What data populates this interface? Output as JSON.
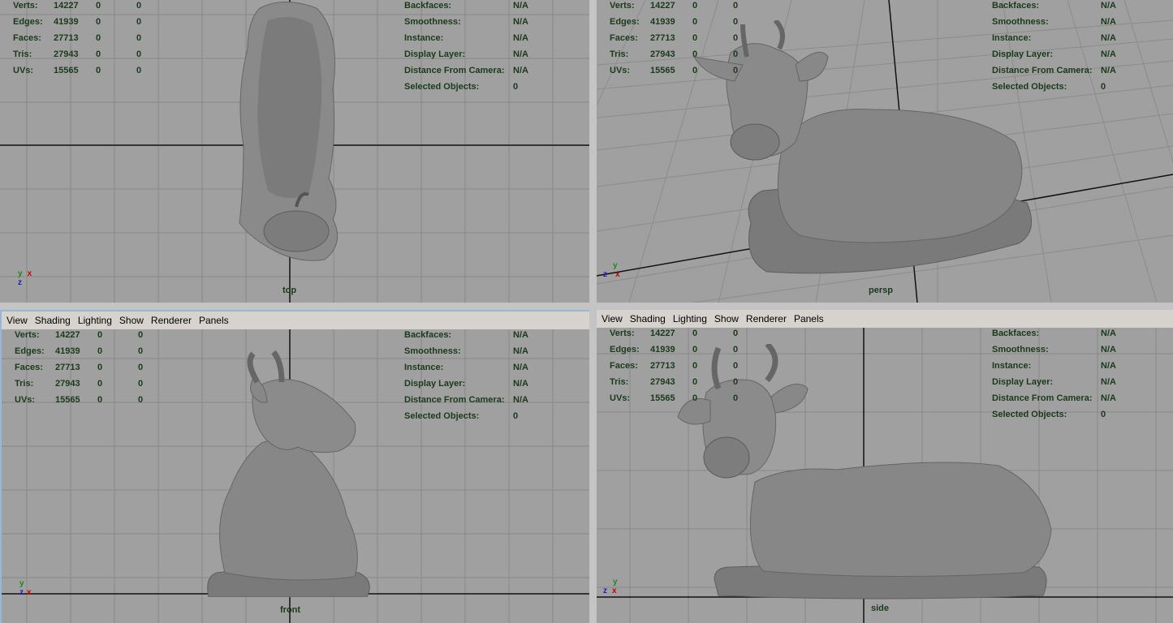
{
  "menu": {
    "view": "View",
    "shading": "Shading",
    "lighting": "Lighting",
    "show": "Show",
    "renderer": "Renderer",
    "panels": "Panels"
  },
  "hud_left": [
    {
      "label": "Verts:",
      "v1": "14227",
      "v2": "0",
      "v3": "0"
    },
    {
      "label": "Edges:",
      "v1": "41939",
      "v2": "0",
      "v3": "0"
    },
    {
      "label": "Faces:",
      "v1": "27713",
      "v2": "0",
      "v3": "0"
    },
    {
      "label": "Tris:",
      "v1": "27943",
      "v2": "0",
      "v3": "0"
    },
    {
      "label": "UVs:",
      "v1": "15565",
      "v2": "0",
      "v3": "0"
    }
  ],
  "hud_right": [
    {
      "label": "Backfaces:",
      "value": "N/A"
    },
    {
      "label": "Smoothness:",
      "value": "N/A"
    },
    {
      "label": "Instance:",
      "value": "N/A"
    },
    {
      "label": "Display Layer:",
      "value": "N/A"
    },
    {
      "label": "Distance From Camera:",
      "value": "N/A"
    },
    {
      "label": "Selected Objects:",
      "value": "0"
    }
  ],
  "cameras": {
    "top": "top",
    "persp": "persp",
    "front": "front",
    "side": "side"
  },
  "axes": {
    "x": "x",
    "y": "y",
    "z": "z"
  },
  "colors": {
    "viewport_bg": "#a0a0a0",
    "grid": "#8a8a8a",
    "hud_text": "#1a3a1a",
    "model": "#7a7a7a",
    "menubar": "#d6d3ce",
    "active_border": "#9ab5d6"
  }
}
